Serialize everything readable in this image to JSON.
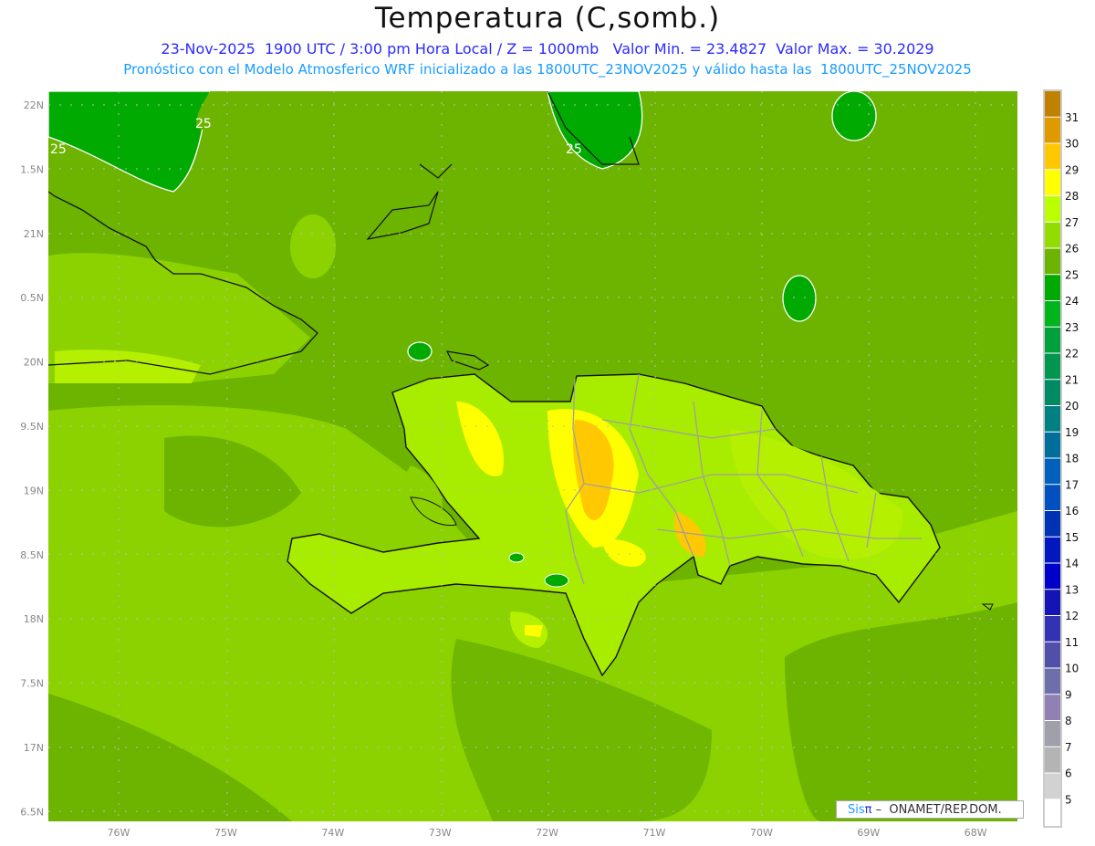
{
  "header": {
    "title": "Temperatura (C,somb.)",
    "line1": "23-Nov-2025  1900 UTC / 3:00 pm Hora Local / Z = 1000mb   Valor Min. = 23.4827  Valor Max. = 30.2029",
    "line2": "Pronóstico con el Modelo Atmosferico WRF inicializado a las 1800UTC_23NOV2025 y válido hasta las  1800UTC_25NOV2025"
  },
  "map": {
    "lon_labels": [
      "76W",
      "75W",
      "74W",
      "73W",
      "72W",
      "71W",
      "70W",
      "69W",
      "68W"
    ],
    "lat_labels": [
      "22N",
      "1.5N",
      "21N",
      "0.5N",
      "20N",
      "9.5N",
      "19N",
      "8.5N",
      "18N",
      "7.5N",
      "17N",
      "6.5N"
    ],
    "contour_labels": [
      "25",
      "25",
      "25"
    ]
  },
  "colorbar": {
    "labels": [
      "31",
      "30",
      "29",
      "28",
      "27",
      "26",
      "25",
      "24",
      "23",
      "22",
      "21",
      "20",
      "19",
      "18",
      "17",
      "16",
      "15",
      "14",
      "13",
      "12",
      "11",
      "10",
      "9",
      "8",
      "7",
      "6",
      "5"
    ],
    "colors": [
      "#c08000",
      "#e09a00",
      "#ffc800",
      "#ffff00",
      "#bcff00",
      "#94dc00",
      "#6cb400",
      "#00aa00",
      "#00b41e",
      "#00a03c",
      "#009650",
      "#008a64",
      "#008080",
      "#006e9b",
      "#0060bc",
      "#0050c0",
      "#0032b4",
      "#0018be",
      "#0000c8",
      "#1414b4",
      "#3232b4",
      "#5050aa",
      "#6e6eaa",
      "#9080b4",
      "#a0a0aa",
      "#b4b4b4",
      "#d2d2d2",
      "#ffffff"
    ]
  },
  "credit": {
    "sis": "Sis",
    "pi": "π",
    "rest": " –  ONAMET/REP.DOM."
  }
}
